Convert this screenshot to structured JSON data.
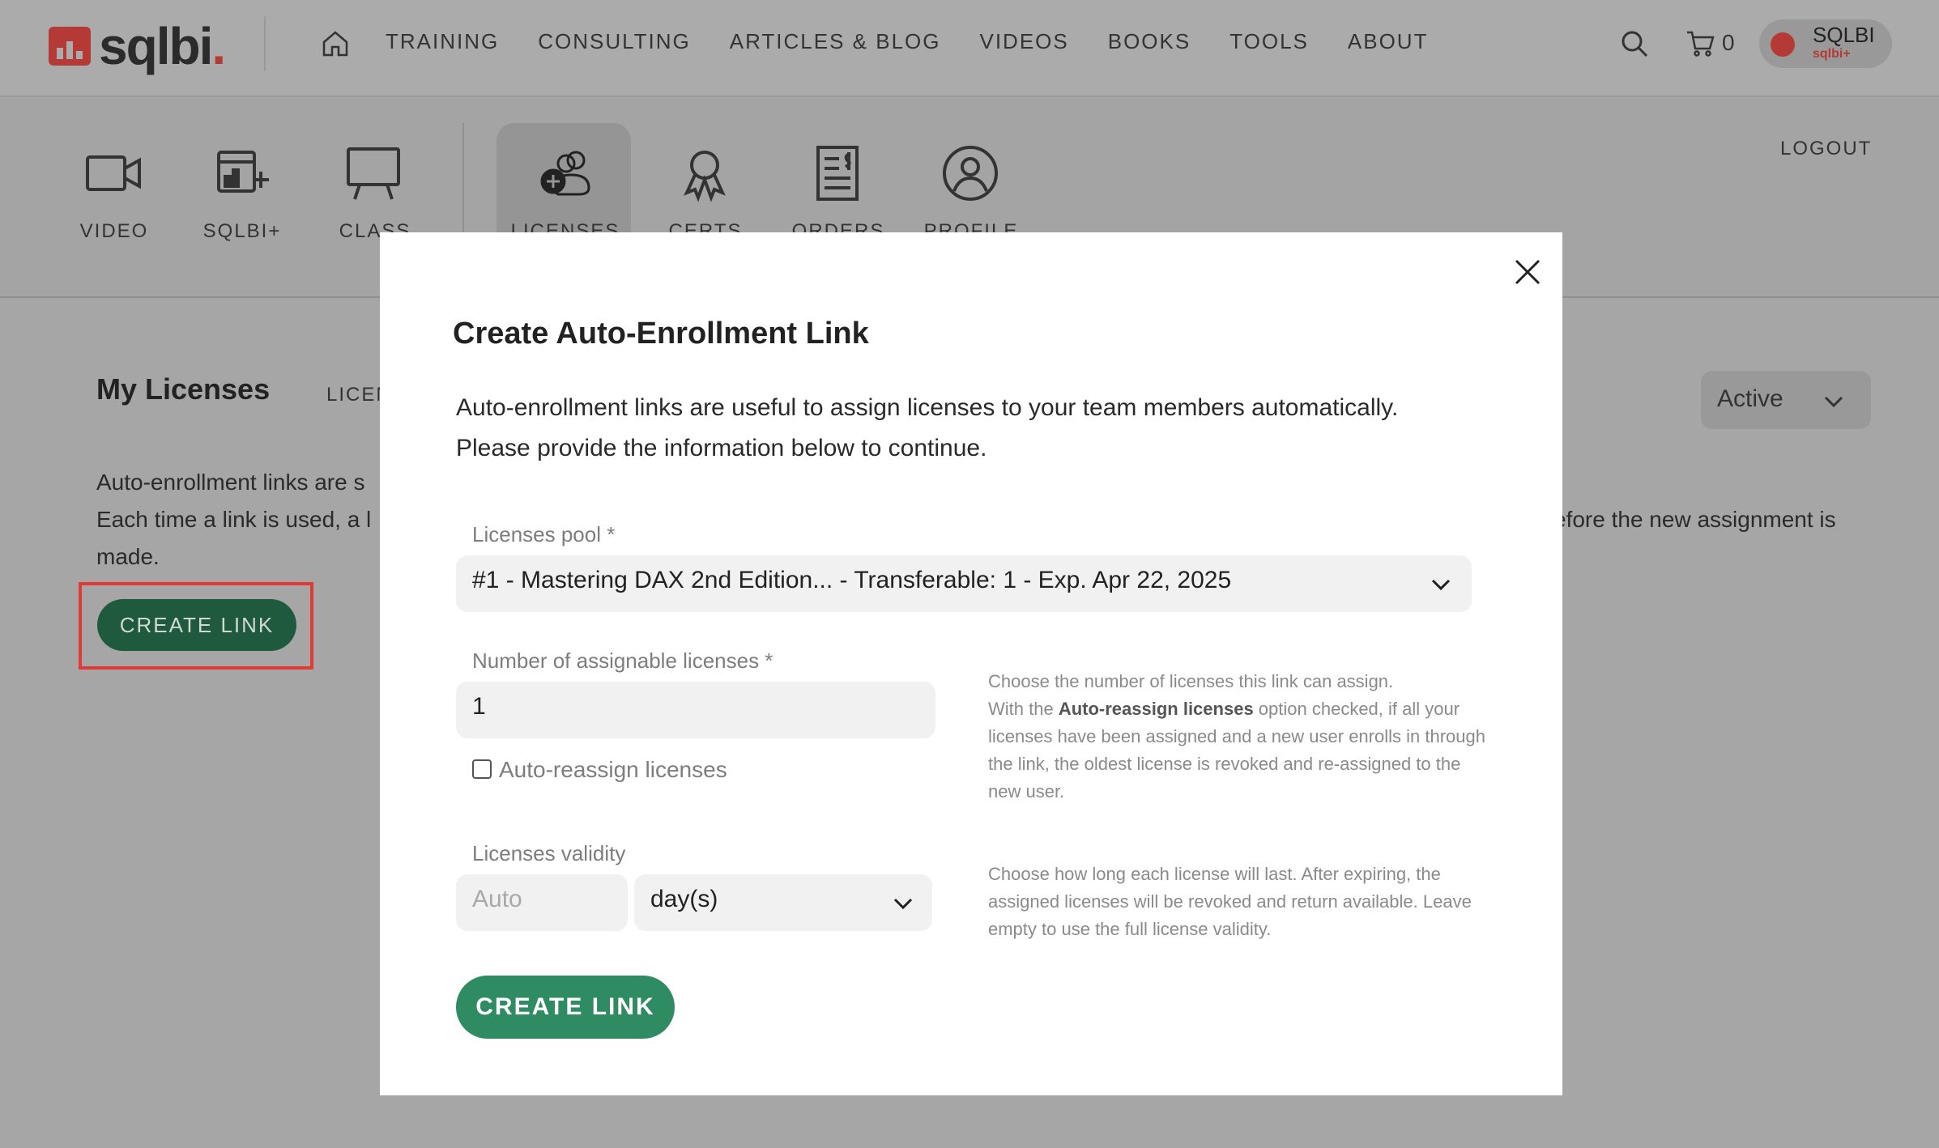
{
  "header": {
    "logo": {
      "text": "sqlbi",
      "dot": "."
    },
    "menu": [
      "TRAINING",
      "CONSULTING",
      "ARTICLES & BLOG",
      "VIDEOS",
      "BOOKS",
      "TOOLS",
      "ABOUT"
    ],
    "cart_count": "0",
    "user": {
      "name": "SQLBI",
      "sub": "sqlbi+"
    }
  },
  "account_nav": {
    "items": [
      {
        "label": "VIDEO",
        "icon": "video-icon"
      },
      {
        "label": "SQLBI+",
        "icon": "sqlbi-plus-icon"
      },
      {
        "label": "CLASS",
        "icon": "class-icon"
      },
      {
        "label": "LICENSES",
        "icon": "licenses-icon",
        "active": true
      },
      {
        "label": "CERTS",
        "icon": "certs-icon"
      },
      {
        "label": "ORDERS",
        "icon": "orders-icon"
      },
      {
        "label": "PROFILE",
        "icon": "profile-icon"
      }
    ],
    "logout": "LOGOUT"
  },
  "page": {
    "title": "My Licenses",
    "tab": "LICEN",
    "filter": "Active",
    "desc_left": [
      "Auto-enrollment links are s",
      "Each time a link is used, a l",
      "made."
    ],
    "desc_right": "efore the new assignment is",
    "create_button": "CREATE LINK"
  },
  "modal": {
    "title": "Create Auto-Enrollment Link",
    "intro": [
      "Auto-enrollment links are useful to assign licenses to your team members automatically.",
      "Please provide the information below to continue."
    ],
    "pool_label": "Licenses pool *",
    "pool_value": "#1 - Mastering DAX 2nd Edition... - Transferable: 1 - Exp. Apr 22, 2025",
    "count_label": "Number of assignable licenses *",
    "count_value": "1",
    "auto_reassign_label": "Auto-reassign licenses",
    "auto_reassign_checked": false,
    "count_hint": {
      "line1": "Choose the number of licenses this link can assign.",
      "pre": "With the ",
      "bold": "Auto-reassign licenses",
      "post": " option checked, if all your licenses have been assigned and a new user enrolls in through the link, the oldest license is revoked and re-assigned to the new user."
    },
    "validity_label": "Licenses validity",
    "validity_placeholder": "Auto",
    "validity_unit": "day(s)",
    "validity_hint": "Choose how long each license will last. After expiring, the assigned licenses will be revoked and return available. Leave empty to use the full license validity.",
    "create_button": "CREATE LINK"
  },
  "colors": {
    "brand_red": "#b53a35",
    "button_green": "#2e8b62",
    "highlight_red": "#e53935"
  }
}
